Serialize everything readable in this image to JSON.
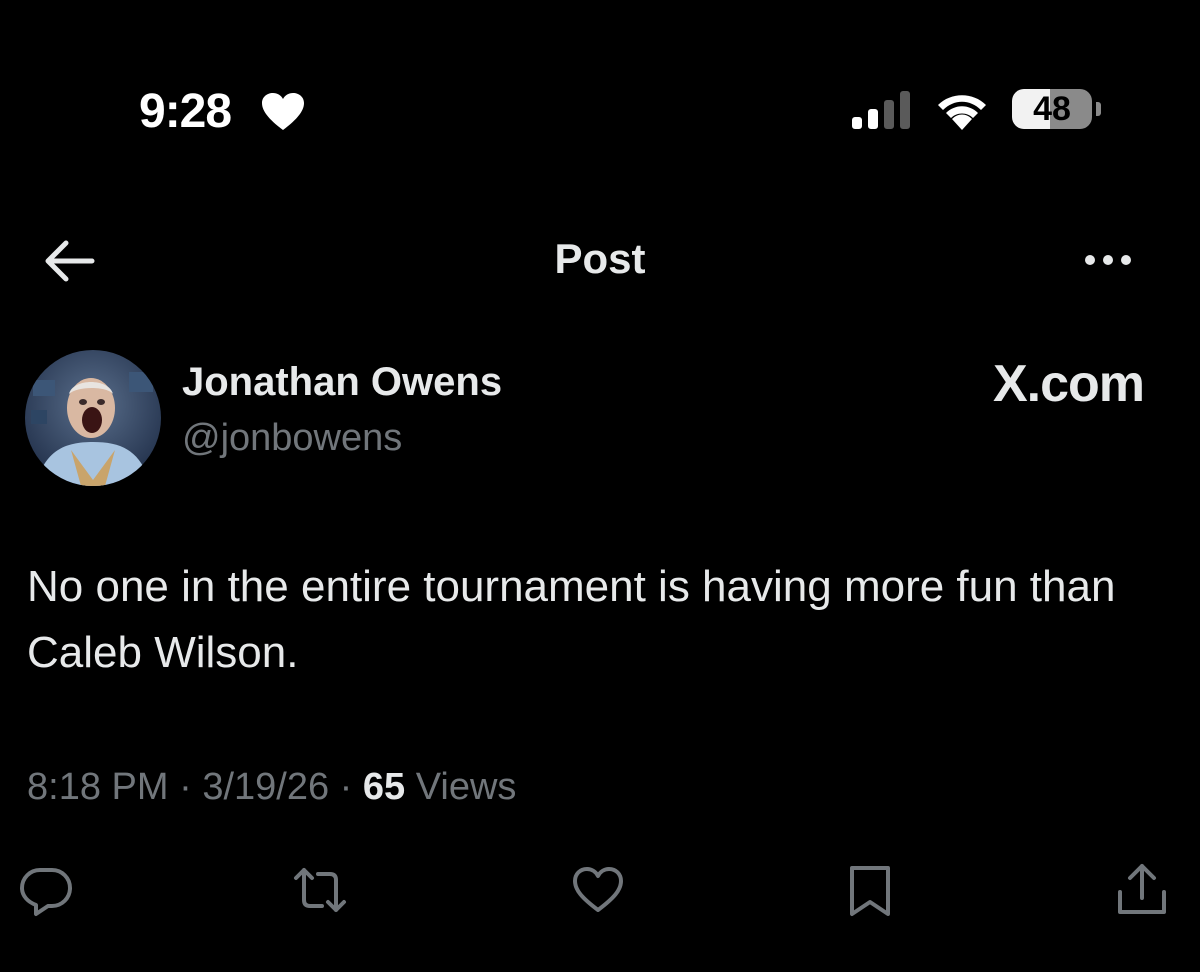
{
  "status_bar": {
    "time": "9:28",
    "battery": "48",
    "battery_level": 0.48,
    "icons": [
      "heart-icon",
      "cellular-signal-icon",
      "wifi-icon",
      "battery-icon"
    ]
  },
  "nav": {
    "title": "Post",
    "back_icon": "arrow-left-icon",
    "more_icon": "more-horizontal-icon"
  },
  "post": {
    "author_name": "Jonathan Owens",
    "author_handle": "@jonbowens",
    "source": "X.com",
    "text": "No one in the entire tournament is having more fun than Caleb Wilson.",
    "time": "8:18 PM",
    "date": "3/19/26",
    "separator": " · ",
    "views_count": "65",
    "views_label": "Views"
  },
  "actions": [
    "reply-icon",
    "repost-icon",
    "like-icon",
    "bookmark-icon",
    "share-icon"
  ],
  "colors": {
    "background": "#000000",
    "text_primary": "#e7e9ea",
    "text_secondary": "#71767b",
    "icon": "#71767b"
  }
}
